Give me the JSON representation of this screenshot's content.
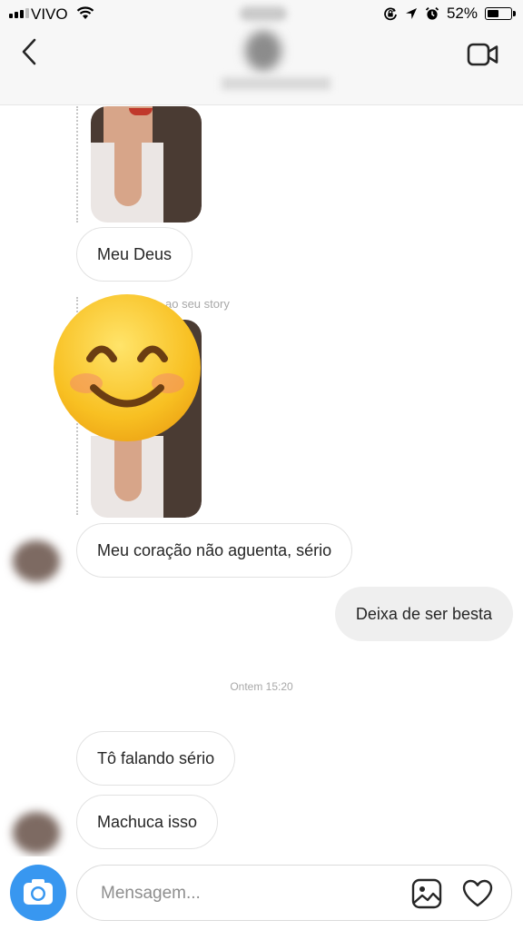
{
  "status_bar": {
    "carrier": "VIVO",
    "battery_percent": "52%",
    "battery_level": 0.52,
    "icons": [
      "signal-icon",
      "wifi-icon",
      "screen-lock-icon",
      "location-icon",
      "alarm-icon",
      "battery-icon"
    ]
  },
  "header": {
    "icons": [
      "back-chevron-icon",
      "video-camera-icon"
    ]
  },
  "messages": {
    "m1": "Meu Deus",
    "story_caption": "ao seu story",
    "m2": "Meu coração não aguenta, sério",
    "m3": "Deixa de ser besta",
    "timestamp": "Ontem 15:20",
    "m4": "Tô falando sério",
    "m5": "Machuca isso"
  },
  "composer": {
    "placeholder": "Mensagem...",
    "icons": [
      "camera-icon",
      "gallery-icon",
      "heart-icon"
    ]
  },
  "colors": {
    "accent": "#3897f0",
    "incoming_border": "#e2e2e2",
    "outgoing_bubble": "#efefef"
  }
}
